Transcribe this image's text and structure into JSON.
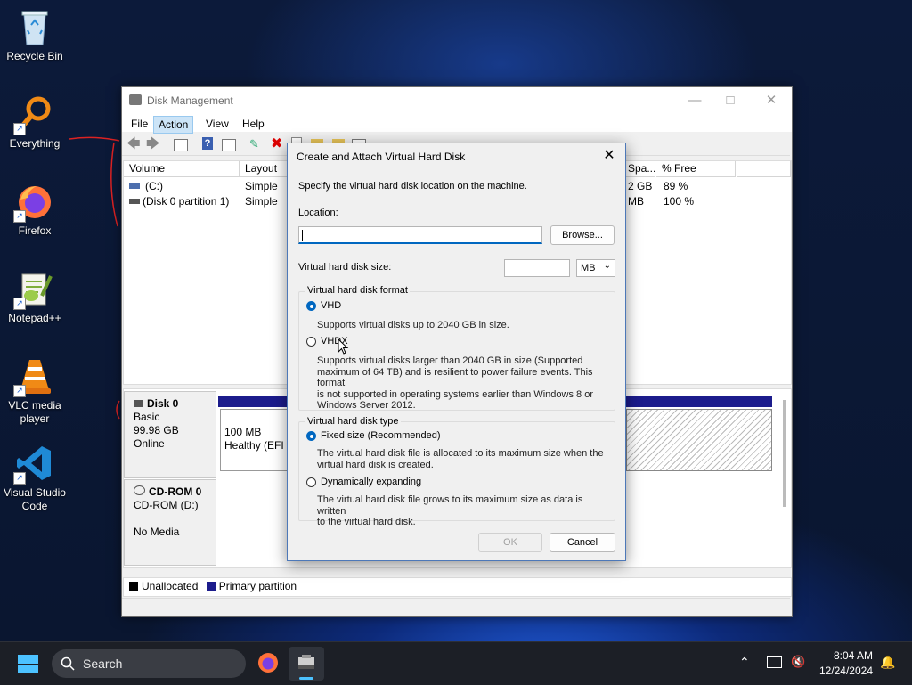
{
  "desktop": {
    "icons": [
      {
        "label": "Recycle Bin",
        "icon": "recycle-bin-icon"
      },
      {
        "label": "Everything",
        "icon": "everything-search-icon"
      },
      {
        "label": "Firefox",
        "icon": "firefox-icon"
      },
      {
        "label": "Notepad++",
        "icon": "notepad-plus-plus-icon"
      },
      {
        "label": "VLC media\nplayer",
        "label_lines": [
          "VLC media",
          "player"
        ],
        "icon": "vlc-icon"
      },
      {
        "label_lines": [
          "Visual Studio",
          "Code"
        ],
        "icon": "vscode-icon"
      }
    ]
  },
  "window": {
    "title": "Disk Management",
    "menu": [
      "File",
      "Action",
      "View",
      "Help"
    ],
    "active_menu": "Action",
    "columns": [
      "Volume",
      "Layout",
      "Spa...",
      "% Free"
    ],
    "volumes": [
      {
        "volume": "(C:)",
        "layout": "Simple",
        "space": "2 GB",
        "free": "89 %"
      },
      {
        "volume": "(Disk 0 partition 1)",
        "layout": "Simple",
        "space": "MB",
        "free": "100 %"
      }
    ],
    "disks": [
      {
        "name": "Disk 0",
        "type": "Basic",
        "size": "99.98 GB",
        "status": "Online",
        "partition_size": "100 MB",
        "partition_status": "Healthy (EFI S"
      },
      {
        "name": "CD-ROM 0",
        "type": "CD-ROM (D:)",
        "status": "No Media"
      }
    ],
    "legend": [
      {
        "label": "Unallocated",
        "color": "#000000"
      },
      {
        "label": "Primary partition",
        "color": "#1c1c8c"
      }
    ]
  },
  "dialog": {
    "title": "Create and Attach Virtual Hard Disk",
    "instruction": "Specify the virtual hard disk location on the machine.",
    "location_label": "Location:",
    "location_value": "",
    "browse_label": "Browse...",
    "size_label": "Virtual hard disk size:",
    "size_value": "",
    "size_unit": "MB",
    "format_group": "Virtual hard disk format",
    "format_options": [
      {
        "label": "VHD",
        "selected": true,
        "desc": "Supports virtual disks up to 2040 GB in size."
      },
      {
        "label": "VHDX",
        "selected": false,
        "desc_lines": [
          "Supports virtual disks larger than 2040 GB in size (Supported",
          "maximum of 64 TB) and is resilient to power failure events. This format",
          "is not supported in operating systems earlier than Windows 8 or",
          "Windows Server 2012."
        ]
      }
    ],
    "type_group": "Virtual hard disk type",
    "type_options": [
      {
        "label": "Fixed size (Recommended)",
        "selected": true,
        "desc_lines": [
          "The virtual hard disk file is allocated to its maximum size when the",
          "virtual hard disk is created."
        ]
      },
      {
        "label": "Dynamically expanding",
        "selected": false,
        "desc_lines": [
          "The virtual hard disk file grows to its maximum size as data is written",
          "to the virtual hard disk."
        ]
      }
    ],
    "ok_label": "OK",
    "cancel_label": "Cancel"
  },
  "taskbar": {
    "search_label": "Search",
    "time": "8:04 AM",
    "date": "12/24/2024"
  },
  "colors": {
    "accent": "#0067c0",
    "primary_partition": "#1c1c8c"
  }
}
